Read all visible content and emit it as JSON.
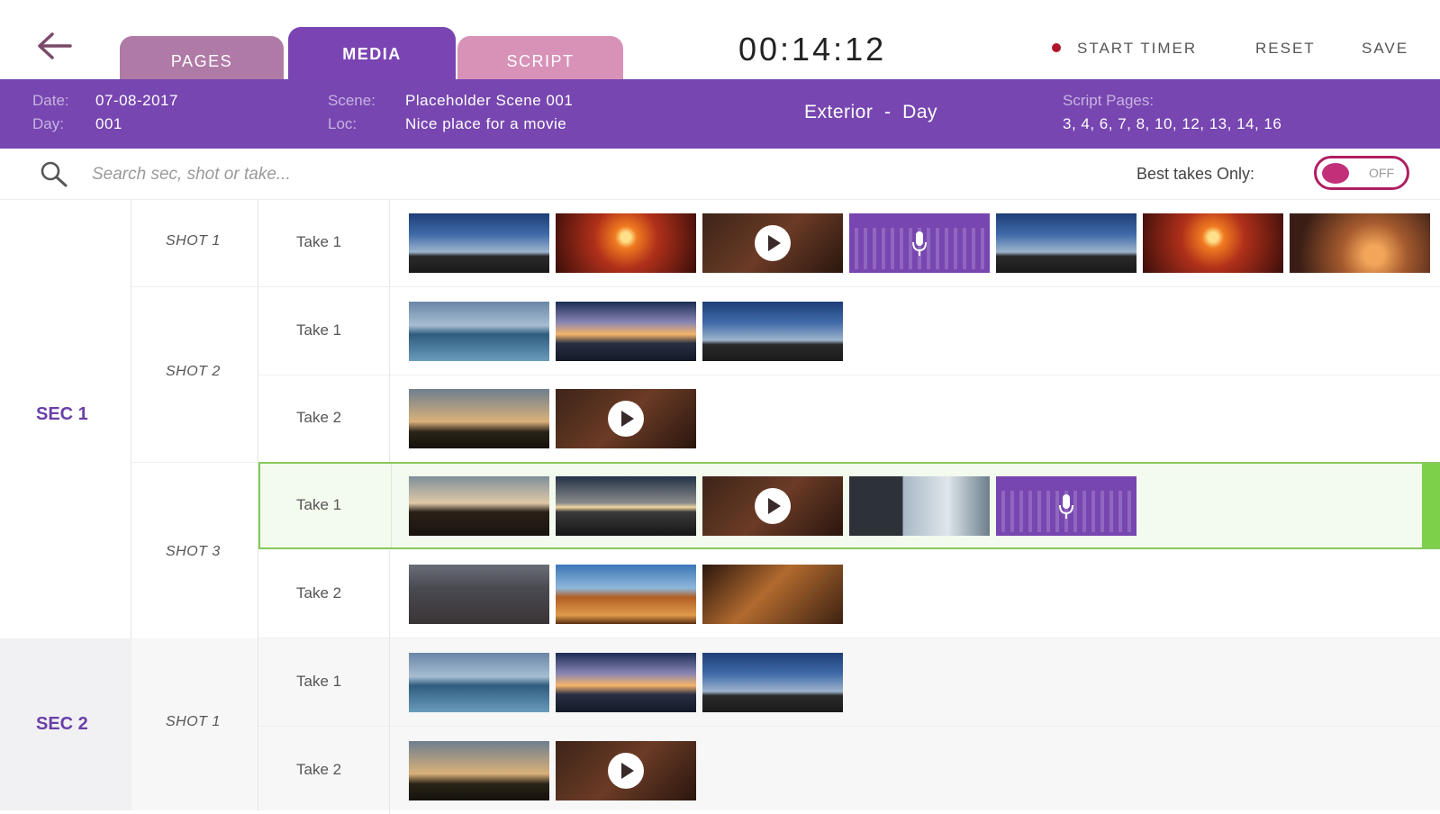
{
  "tabs": [
    {
      "label": "PAGES"
    },
    {
      "label": "MEDIA"
    },
    {
      "label": "SCRIPT"
    }
  ],
  "timer": "00:14:12",
  "actions": {
    "start_timer": "START TIMER",
    "reset": "RESET",
    "save": "SAVE"
  },
  "info": {
    "date_label": "Date:",
    "date_value": "07-08-2017",
    "day_label": "Day:",
    "day_value": "001",
    "scene_label": "Scene:",
    "scene_value": "Placeholder Scene 001",
    "loc_label": "Loc:",
    "loc_value": "Nice place for a movie",
    "setting": "Exterior  -  Day",
    "script_pages_label": "Script Pages:",
    "script_pages_value": "3, 4, 6, 7, 8, 10, 12, 13, 14, 16"
  },
  "search": {
    "placeholder": "Search sec, shot or take..."
  },
  "best_takes": {
    "label": "Best takes Only:",
    "state": "OFF"
  },
  "sections": [
    {
      "label": "SEC 1",
      "shots": [
        {
          "label": "SHOT 1",
          "takes": [
            {
              "label": "Take 1",
              "media": [
                "sky",
                "sunset",
                "video",
                "audio",
                "sky",
                "sunset",
                "dusk"
              ]
            }
          ]
        },
        {
          "label": "SHOT 2",
          "takes": [
            {
              "label": "Take 1",
              "media": [
                "lake",
                "clouds",
                "sky"
              ]
            },
            {
              "label": "Take 2",
              "media": [
                "silhouette",
                "video"
              ]
            }
          ]
        },
        {
          "label": "SHOT 3",
          "takes": [
            {
              "label": "Take 1",
              "media": [
                "tree",
                "horizon",
                "video",
                "window",
                "audio"
              ],
              "selected": true
            },
            {
              "label": "Take 2",
              "media": [
                "city",
                "desert",
                "palm"
              ]
            }
          ]
        }
      ]
    },
    {
      "label": "SEC 2",
      "shots": [
        {
          "label": "SHOT 1",
          "takes": [
            {
              "label": "Take 1",
              "media": [
                "lake",
                "clouds",
                "sky"
              ]
            },
            {
              "label": "Take 2",
              "media": [
                "silhouette",
                "video"
              ]
            }
          ]
        }
      ]
    }
  ],
  "colors": {
    "accent": "#7746b0",
    "toggle": "#c2307a",
    "selected_border": "#86c95a"
  }
}
